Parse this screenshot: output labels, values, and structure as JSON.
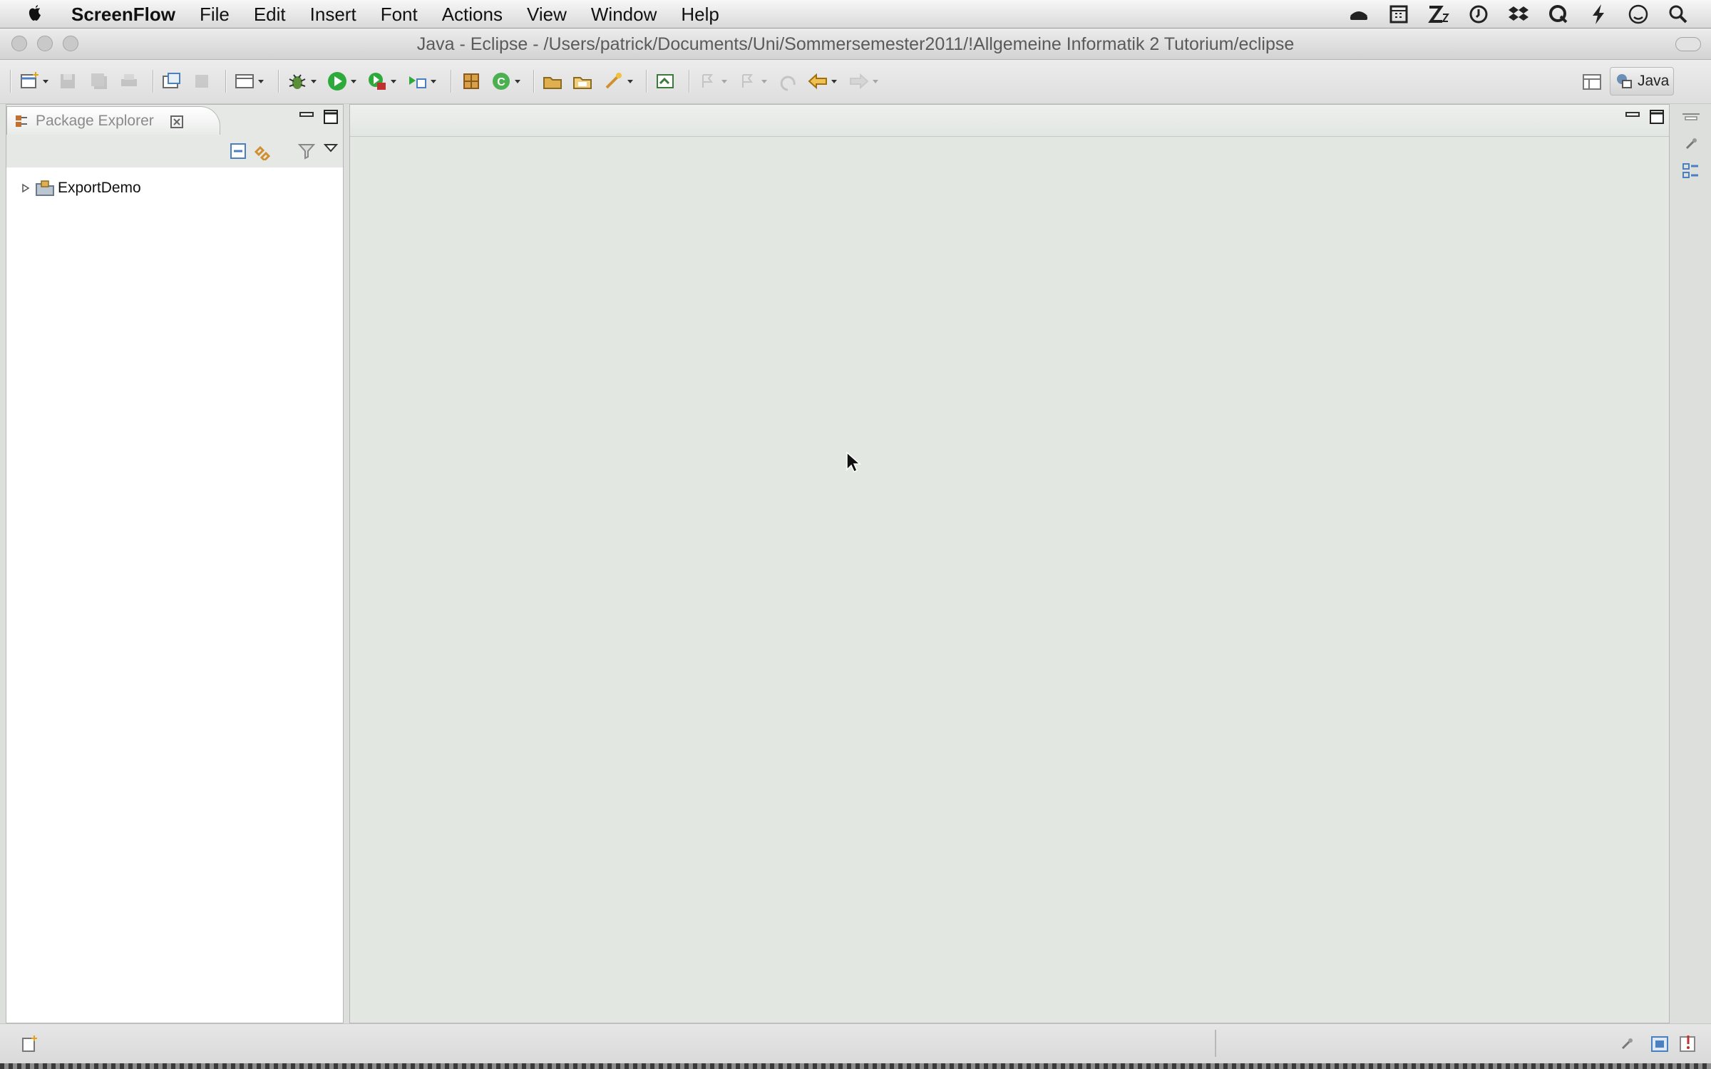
{
  "menubar": {
    "app_name": "ScreenFlow",
    "items": [
      "File",
      "Edit",
      "Insert",
      "Font",
      "Actions",
      "View",
      "Window",
      "Help"
    ],
    "tray_icons": [
      "drive-icon",
      "calendar-icon",
      "zz-icon",
      "clock-icon",
      "dropbox-icon",
      "quicksilver-icon",
      "bolt-icon",
      "user-icon",
      "spotlight-icon"
    ]
  },
  "window": {
    "title": "Java - Eclipse - /Users/patrick/Documents/Uni/Sommersemester2011/!Allgemeine Informatik 2 Tutorium/eclipse"
  },
  "toolbar": {
    "perspective_label": "Java"
  },
  "package_explorer": {
    "tab_label": "Package Explorer",
    "tree": [
      {
        "label": "ExportDemo",
        "expanded": false
      }
    ]
  },
  "colors": {
    "editor_bg": "#e3e7e2",
    "run_green": "#2eaa3c",
    "accent_blue": "#4a7fc0"
  }
}
